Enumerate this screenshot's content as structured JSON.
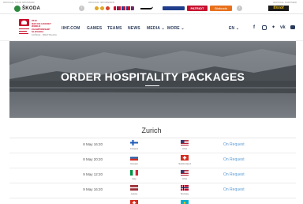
{
  "sponsor_bar": {
    "official_main_sponsor_label": "OFFICIAL MAIN SPONSOR",
    "official_main_sponsor": "ŠKODA",
    "official_sponsors_label": "OFFICIAL SPONSORS",
    "official_partner_label": "OFFICIAL PARTNER",
    "official_partner": "tissot",
    "sponsor_tiles": [
      "PATRIOT",
      "Biofoods"
    ]
  },
  "event": {
    "year": "2019",
    "line1": "IIHF ICE HOCKEY",
    "line2": "WORLD",
    "line3": "CHAMPIONSHIP",
    "line4": "SLOVAKIA",
    "sub": "KOŠICE · BRATISLAVA"
  },
  "nav": {
    "items": [
      "IIHF.COM",
      "GAMES",
      "TEAMS",
      "NEWS",
      "MEDIA ⌄",
      "MORE ⌄"
    ],
    "language": "EN ⌄"
  },
  "hero": {
    "title": "ORDER HOSPITALITY PACKAGES"
  },
  "section": {
    "city": "Zurich",
    "action_label": "On Request",
    "games": [
      {
        "date": "8 May 16:20",
        "home": "Finland",
        "away": "USA"
      },
      {
        "date": "8 May 20:20",
        "home": "Russia",
        "away": "Switzerland"
      },
      {
        "date": "9 May 12:20",
        "home": "Italy",
        "away": "USA"
      },
      {
        "date": "9 May 16:20",
        "home": "Latvia",
        "away": "Norway"
      },
      {
        "date": "",
        "home": "",
        "away": ""
      }
    ]
  }
}
